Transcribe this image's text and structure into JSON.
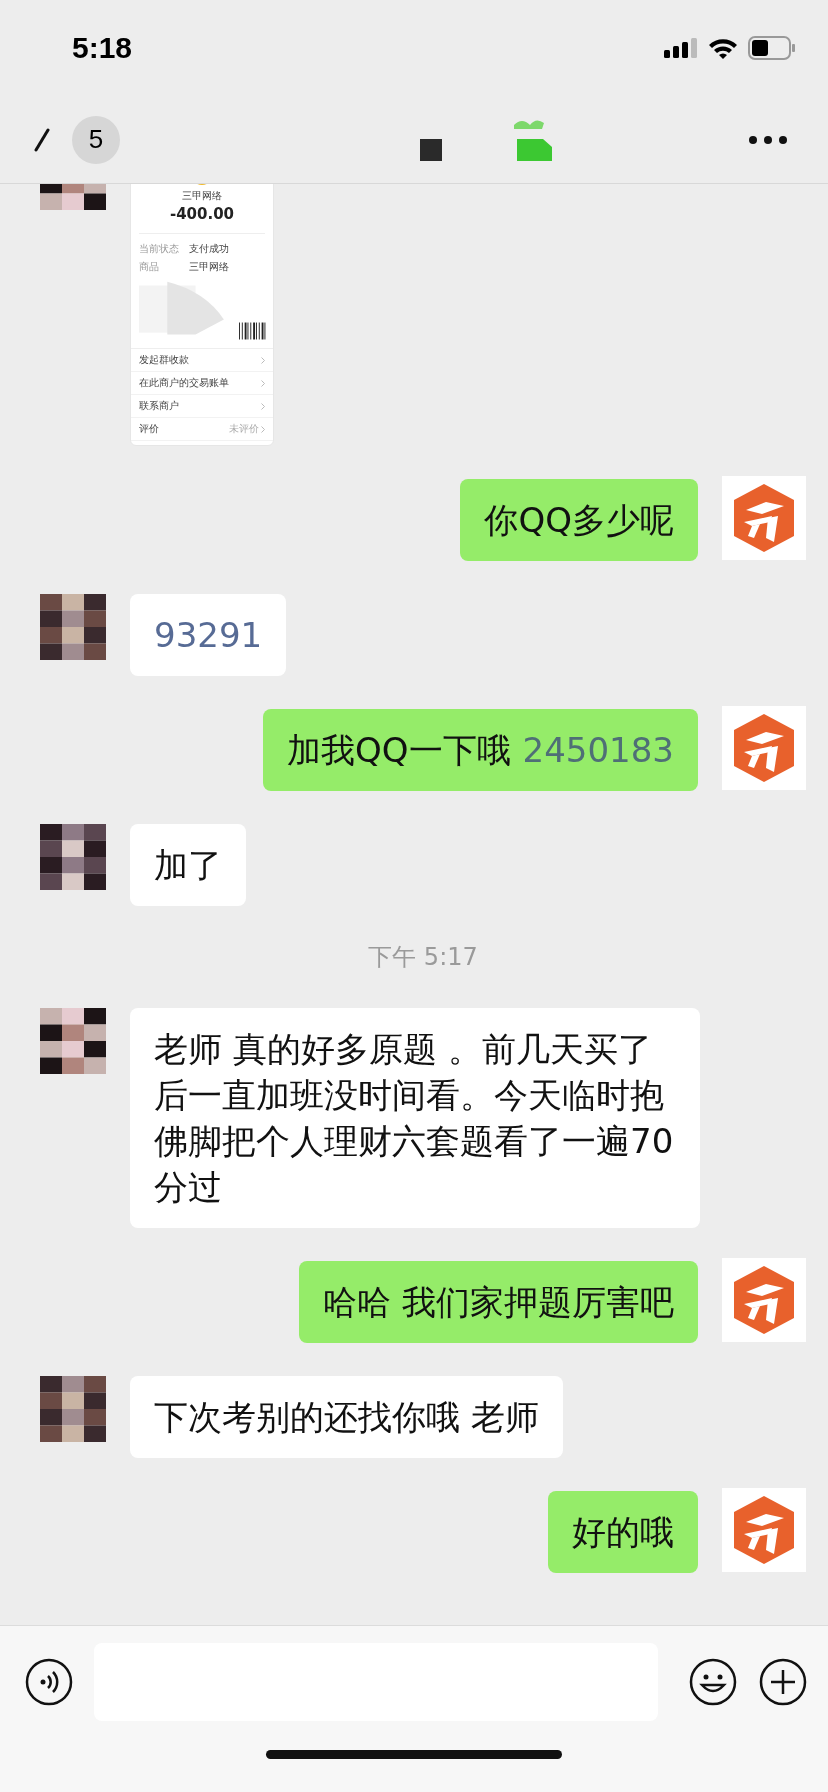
{
  "status_bar": {
    "time": "5:18"
  },
  "nav": {
    "unread_count": "5"
  },
  "messages": [
    {
      "outgoing": false,
      "receipt": {
        "merchant": "三甲网络",
        "amount": "-400.00",
        "fields": [
          {
            "label": "当前状态",
            "value": "支付成功"
          },
          {
            "label": "商品",
            "value": "三甲网络"
          }
        ],
        "actions": [
          {
            "label": "发起群收款"
          },
          {
            "label": "在此商户的交易账单"
          },
          {
            "label": "联系商户"
          },
          {
            "label": "评价",
            "value": "未评价"
          }
        ]
      }
    },
    {
      "kind": "text",
      "outgoing": true,
      "text": "你QQ多少呢"
    },
    {
      "kind": "text",
      "outgoing": false,
      "link": "93291"
    },
    {
      "kind": "text",
      "outgoing": true,
      "text": "加我QQ一下哦",
      "link": "2450183"
    },
    {
      "kind": "text",
      "outgoing": false,
      "text": "加了"
    },
    {
      "kind": "time",
      "text": "下午 5:17"
    },
    {
      "kind": "text",
      "outgoing": false,
      "text": "老师 真的好多原题 。前几天买了后一直加班没时间看。今天临时抱佛脚把个人理财六套题看了一遍70分过"
    },
    {
      "kind": "text",
      "outgoing": true,
      "text": "哈哈 我们家押题厉害吧"
    },
    {
      "kind": "text",
      "outgoing": false,
      "text": "下次考别的还找你哦 老师"
    },
    {
      "kind": "text",
      "outgoing": true,
      "text": "好的哦"
    }
  ]
}
